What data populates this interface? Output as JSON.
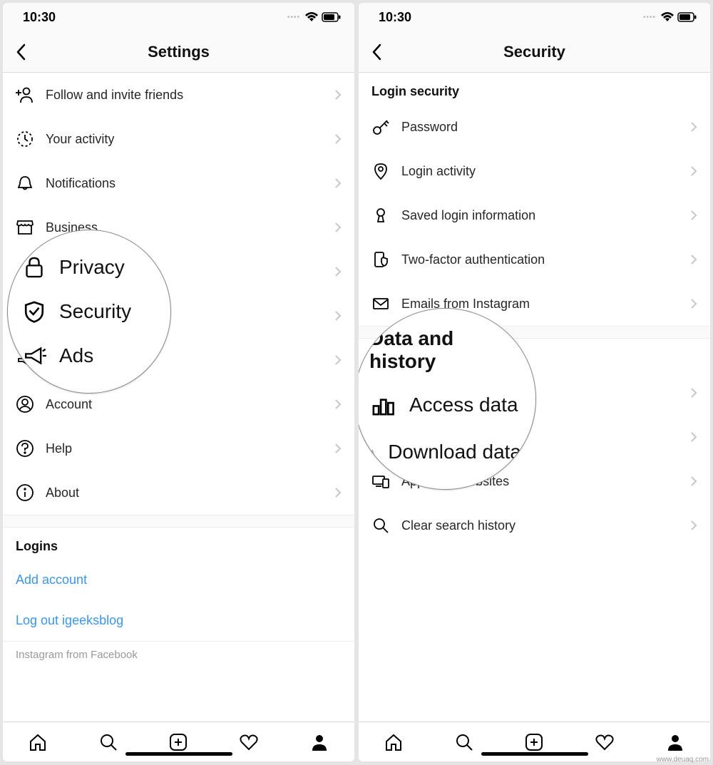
{
  "status": {
    "time": "10:30"
  },
  "left": {
    "title": "Settings",
    "rows": [
      {
        "label": "Follow and invite friends",
        "icon": "invite"
      },
      {
        "label": "Your activity",
        "icon": "activity"
      },
      {
        "label": "Notifications",
        "icon": "bell"
      },
      {
        "label": "Business",
        "icon": "store"
      },
      {
        "label": "Privacy",
        "icon": "lock"
      },
      {
        "label": "Security",
        "icon": "shield"
      },
      {
        "label": "Ads",
        "icon": "megaphone"
      },
      {
        "label": "Account",
        "icon": "account"
      },
      {
        "label": "Help",
        "icon": "help"
      },
      {
        "label": "About",
        "icon": "info"
      }
    ],
    "logins_header": "Logins",
    "add_account": "Add account",
    "log_out": "Log out igeeksblog",
    "footer": "Instagram from Facebook",
    "magnifier": {
      "privacy": "Privacy",
      "security": "Security",
      "ads": "Ads"
    }
  },
  "right": {
    "title": "Security",
    "section1": "Login security",
    "rows1": [
      {
        "label": "Password",
        "icon": "key"
      },
      {
        "label": "Login activity",
        "icon": "pin"
      },
      {
        "label": "Saved login information",
        "icon": "keyhole"
      },
      {
        "label": "Two-factor authentication",
        "icon": "phone-shield"
      },
      {
        "label": "Emails from Instagram",
        "icon": "mail"
      }
    ],
    "section2": "Data and history",
    "rows2": [
      {
        "label": "Access data",
        "icon": "bars"
      },
      {
        "label": "Download data",
        "icon": "download"
      },
      {
        "label": "Apps and websites",
        "icon": "devices"
      },
      {
        "label": "Clear search history",
        "icon": "search"
      }
    ],
    "magnifier": {
      "section": "Data and history",
      "access": "Access data",
      "download": "Download data"
    }
  },
  "watermark": "www.deuaq.com"
}
